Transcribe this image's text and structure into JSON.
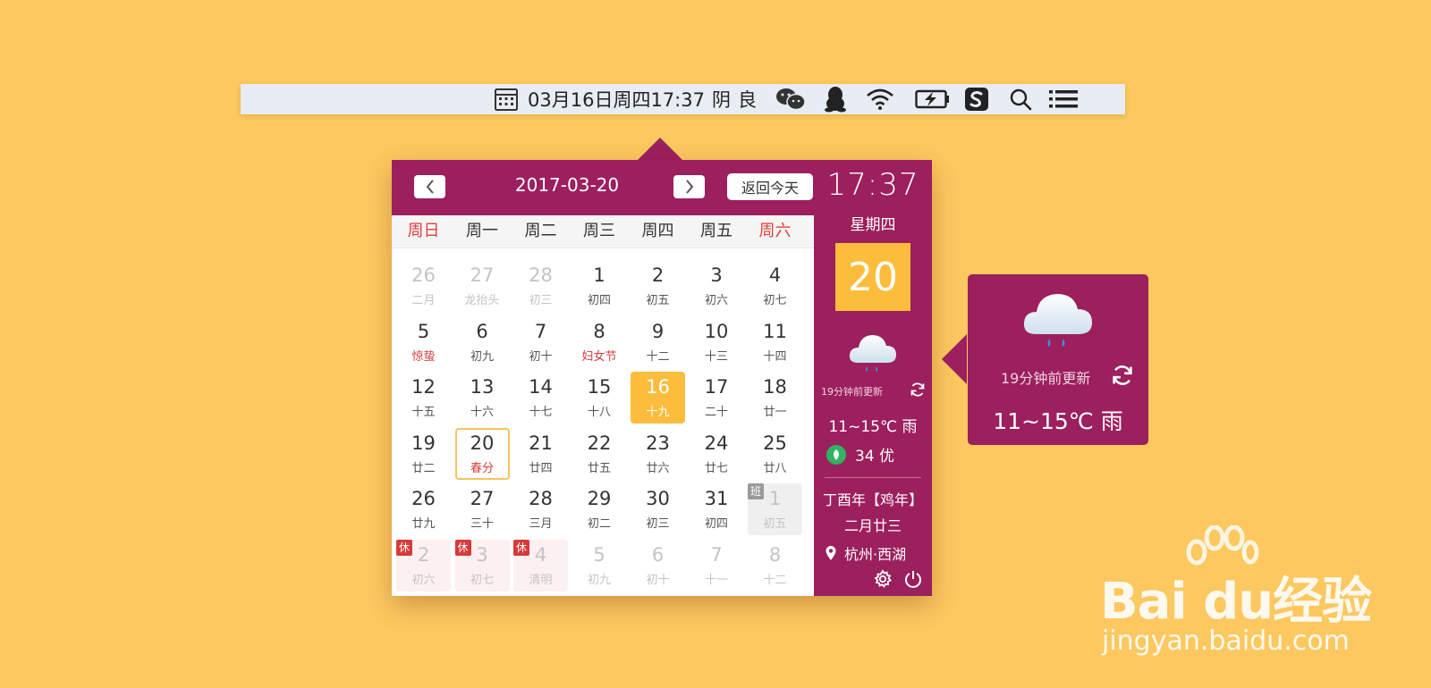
{
  "menubar": {
    "datetime": "03月16日周四17:37",
    "weather": "阴",
    "air_quality": "良",
    "icons": [
      "calendar-icon",
      "wechat-icon",
      "qq-icon",
      "wifi-icon",
      "battery-icon",
      "sogou-icon",
      "search-icon",
      "list-icon"
    ]
  },
  "calendar": {
    "current_date": "2017-03-20",
    "prev_icon": "chevron-left-icon",
    "next_icon": "chevron-right-icon",
    "today_button": "返回今天",
    "weekdays": [
      "周日",
      "周一",
      "周二",
      "周三",
      "周四",
      "周五",
      "周六"
    ],
    "weeks": [
      [
        {
          "d": "26",
          "l": "二月",
          "other": true
        },
        {
          "d": "27",
          "l": "龙抬头",
          "other": true
        },
        {
          "d": "28",
          "l": "初三",
          "other": true
        },
        {
          "d": "1",
          "l": "初四"
        },
        {
          "d": "2",
          "l": "初五"
        },
        {
          "d": "3",
          "l": "初六"
        },
        {
          "d": "4",
          "l": "初七"
        }
      ],
      [
        {
          "d": "5",
          "l": "惊蛰",
          "holiday": true
        },
        {
          "d": "6",
          "l": "初九"
        },
        {
          "d": "7",
          "l": "初十"
        },
        {
          "d": "8",
          "l": "妇女节",
          "holiday": true
        },
        {
          "d": "9",
          "l": "十二"
        },
        {
          "d": "10",
          "l": "十三"
        },
        {
          "d": "11",
          "l": "十四"
        }
      ],
      [
        {
          "d": "12",
          "l": "十五"
        },
        {
          "d": "13",
          "l": "十六"
        },
        {
          "d": "14",
          "l": "十七"
        },
        {
          "d": "15",
          "l": "十八"
        },
        {
          "d": "16",
          "l": "十九",
          "selected": true
        },
        {
          "d": "17",
          "l": "二十"
        },
        {
          "d": "18",
          "l": "廿一"
        }
      ],
      [
        {
          "d": "19",
          "l": "廿二"
        },
        {
          "d": "20",
          "l": "春分",
          "today": true
        },
        {
          "d": "21",
          "l": "廿四"
        },
        {
          "d": "22",
          "l": "廿五"
        },
        {
          "d": "23",
          "l": "廿六"
        },
        {
          "d": "24",
          "l": "廿七"
        },
        {
          "d": "25",
          "l": "廿八"
        }
      ],
      [
        {
          "d": "26",
          "l": "廿九"
        },
        {
          "d": "27",
          "l": "三十"
        },
        {
          "d": "28",
          "l": "三月"
        },
        {
          "d": "29",
          "l": "初二"
        },
        {
          "d": "30",
          "l": "初三"
        },
        {
          "d": "31",
          "l": "初四"
        },
        {
          "d": "1",
          "l": "初五",
          "other": true,
          "tag": "班"
        }
      ],
      [
        {
          "d": "2",
          "l": "初六",
          "other": true,
          "tag": "休"
        },
        {
          "d": "3",
          "l": "初七",
          "other": true,
          "tag": "休"
        },
        {
          "d": "4",
          "l": "清明",
          "other": true,
          "tag": "休"
        },
        {
          "d": "5",
          "l": "初九",
          "other": true
        },
        {
          "d": "6",
          "l": "初十",
          "other": true
        },
        {
          "d": "7",
          "l": "十一",
          "other": true
        },
        {
          "d": "8",
          "l": "十二",
          "other": true
        }
      ]
    ]
  },
  "side": {
    "time": "17:37",
    "weekday": "星期四",
    "day": "20",
    "update": "19分钟前更新",
    "temp": "11~15℃  雨",
    "aqi": "34 优",
    "lunar_year": "丁酉年【鸡年】",
    "lunar_day": "二月廿三",
    "location": "杭州·西湖"
  },
  "weather_tip": {
    "update": "19分钟前更新",
    "temp": "11~15℃  雨"
  },
  "watermark": {
    "logo": "Bai du经验",
    "url": "jingyan.baidu.com"
  },
  "colors": {
    "background": "#FDC85F",
    "accent": "#9C1F5E",
    "highlight": "#FDBD3C",
    "weekend": "#E0403A"
  }
}
